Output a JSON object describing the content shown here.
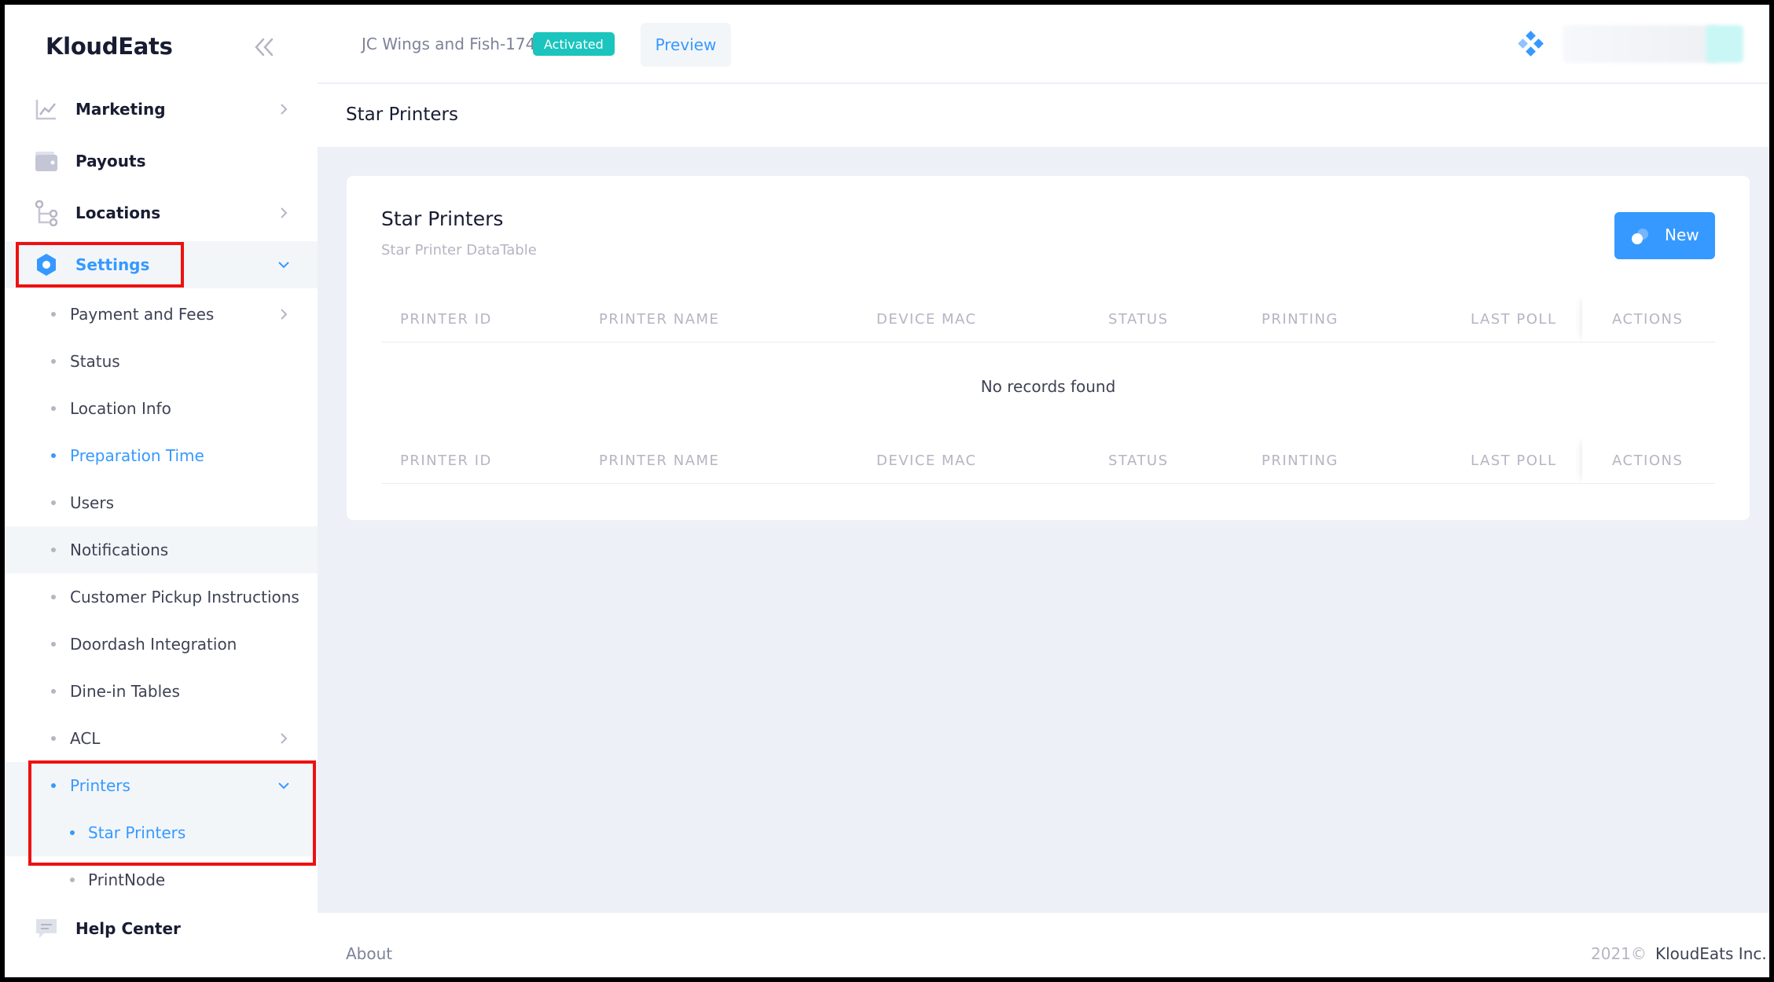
{
  "sidebar": {
    "brand": "KloudEats",
    "items": [
      {
        "label": "Marketing",
        "icon": "chart-line-icon"
      },
      {
        "label": "Payouts",
        "icon": "wallet-icon"
      },
      {
        "label": "Locations",
        "icon": "location-nodes-icon"
      },
      {
        "label": "Settings",
        "icon": "gear-icon"
      }
    ],
    "settings_sub": [
      {
        "label": "Payment and Fees"
      },
      {
        "label": "Status"
      },
      {
        "label": "Location Info"
      },
      {
        "label": "Preparation Time"
      },
      {
        "label": "Users"
      },
      {
        "label": "Notifications"
      },
      {
        "label": "Customer Pickup Instructions"
      },
      {
        "label": "Doordash Integration"
      },
      {
        "label": "Dine-in Tables"
      },
      {
        "label": "ACL"
      },
      {
        "label": "Printers"
      }
    ],
    "printers_sub": [
      {
        "label": "Star Printers"
      },
      {
        "label": "PrintNode"
      }
    ],
    "help": {
      "label": "Help Center",
      "icon": "chat-icon"
    }
  },
  "header": {
    "store_name": "JC Wings and Fish-174",
    "status_badge": "Activated",
    "preview_label": "Preview"
  },
  "subheader": {
    "title": "Star Printers"
  },
  "card": {
    "title": "Star Printers",
    "subtitle": "Star Printer DataTable",
    "new_button_label": "New",
    "columns": [
      "Printer ID",
      "Printer Name",
      "Device MAC",
      "Status",
      "Printing",
      "Last Poll",
      "Actions"
    ],
    "empty_text": "No records found"
  },
  "footer": {
    "about": "About",
    "year": "2021©",
    "company": "KloudEats Inc."
  },
  "colors": {
    "accent": "#3699ff",
    "badge": "#1bc5bd",
    "highlight": "#ee1111"
  }
}
